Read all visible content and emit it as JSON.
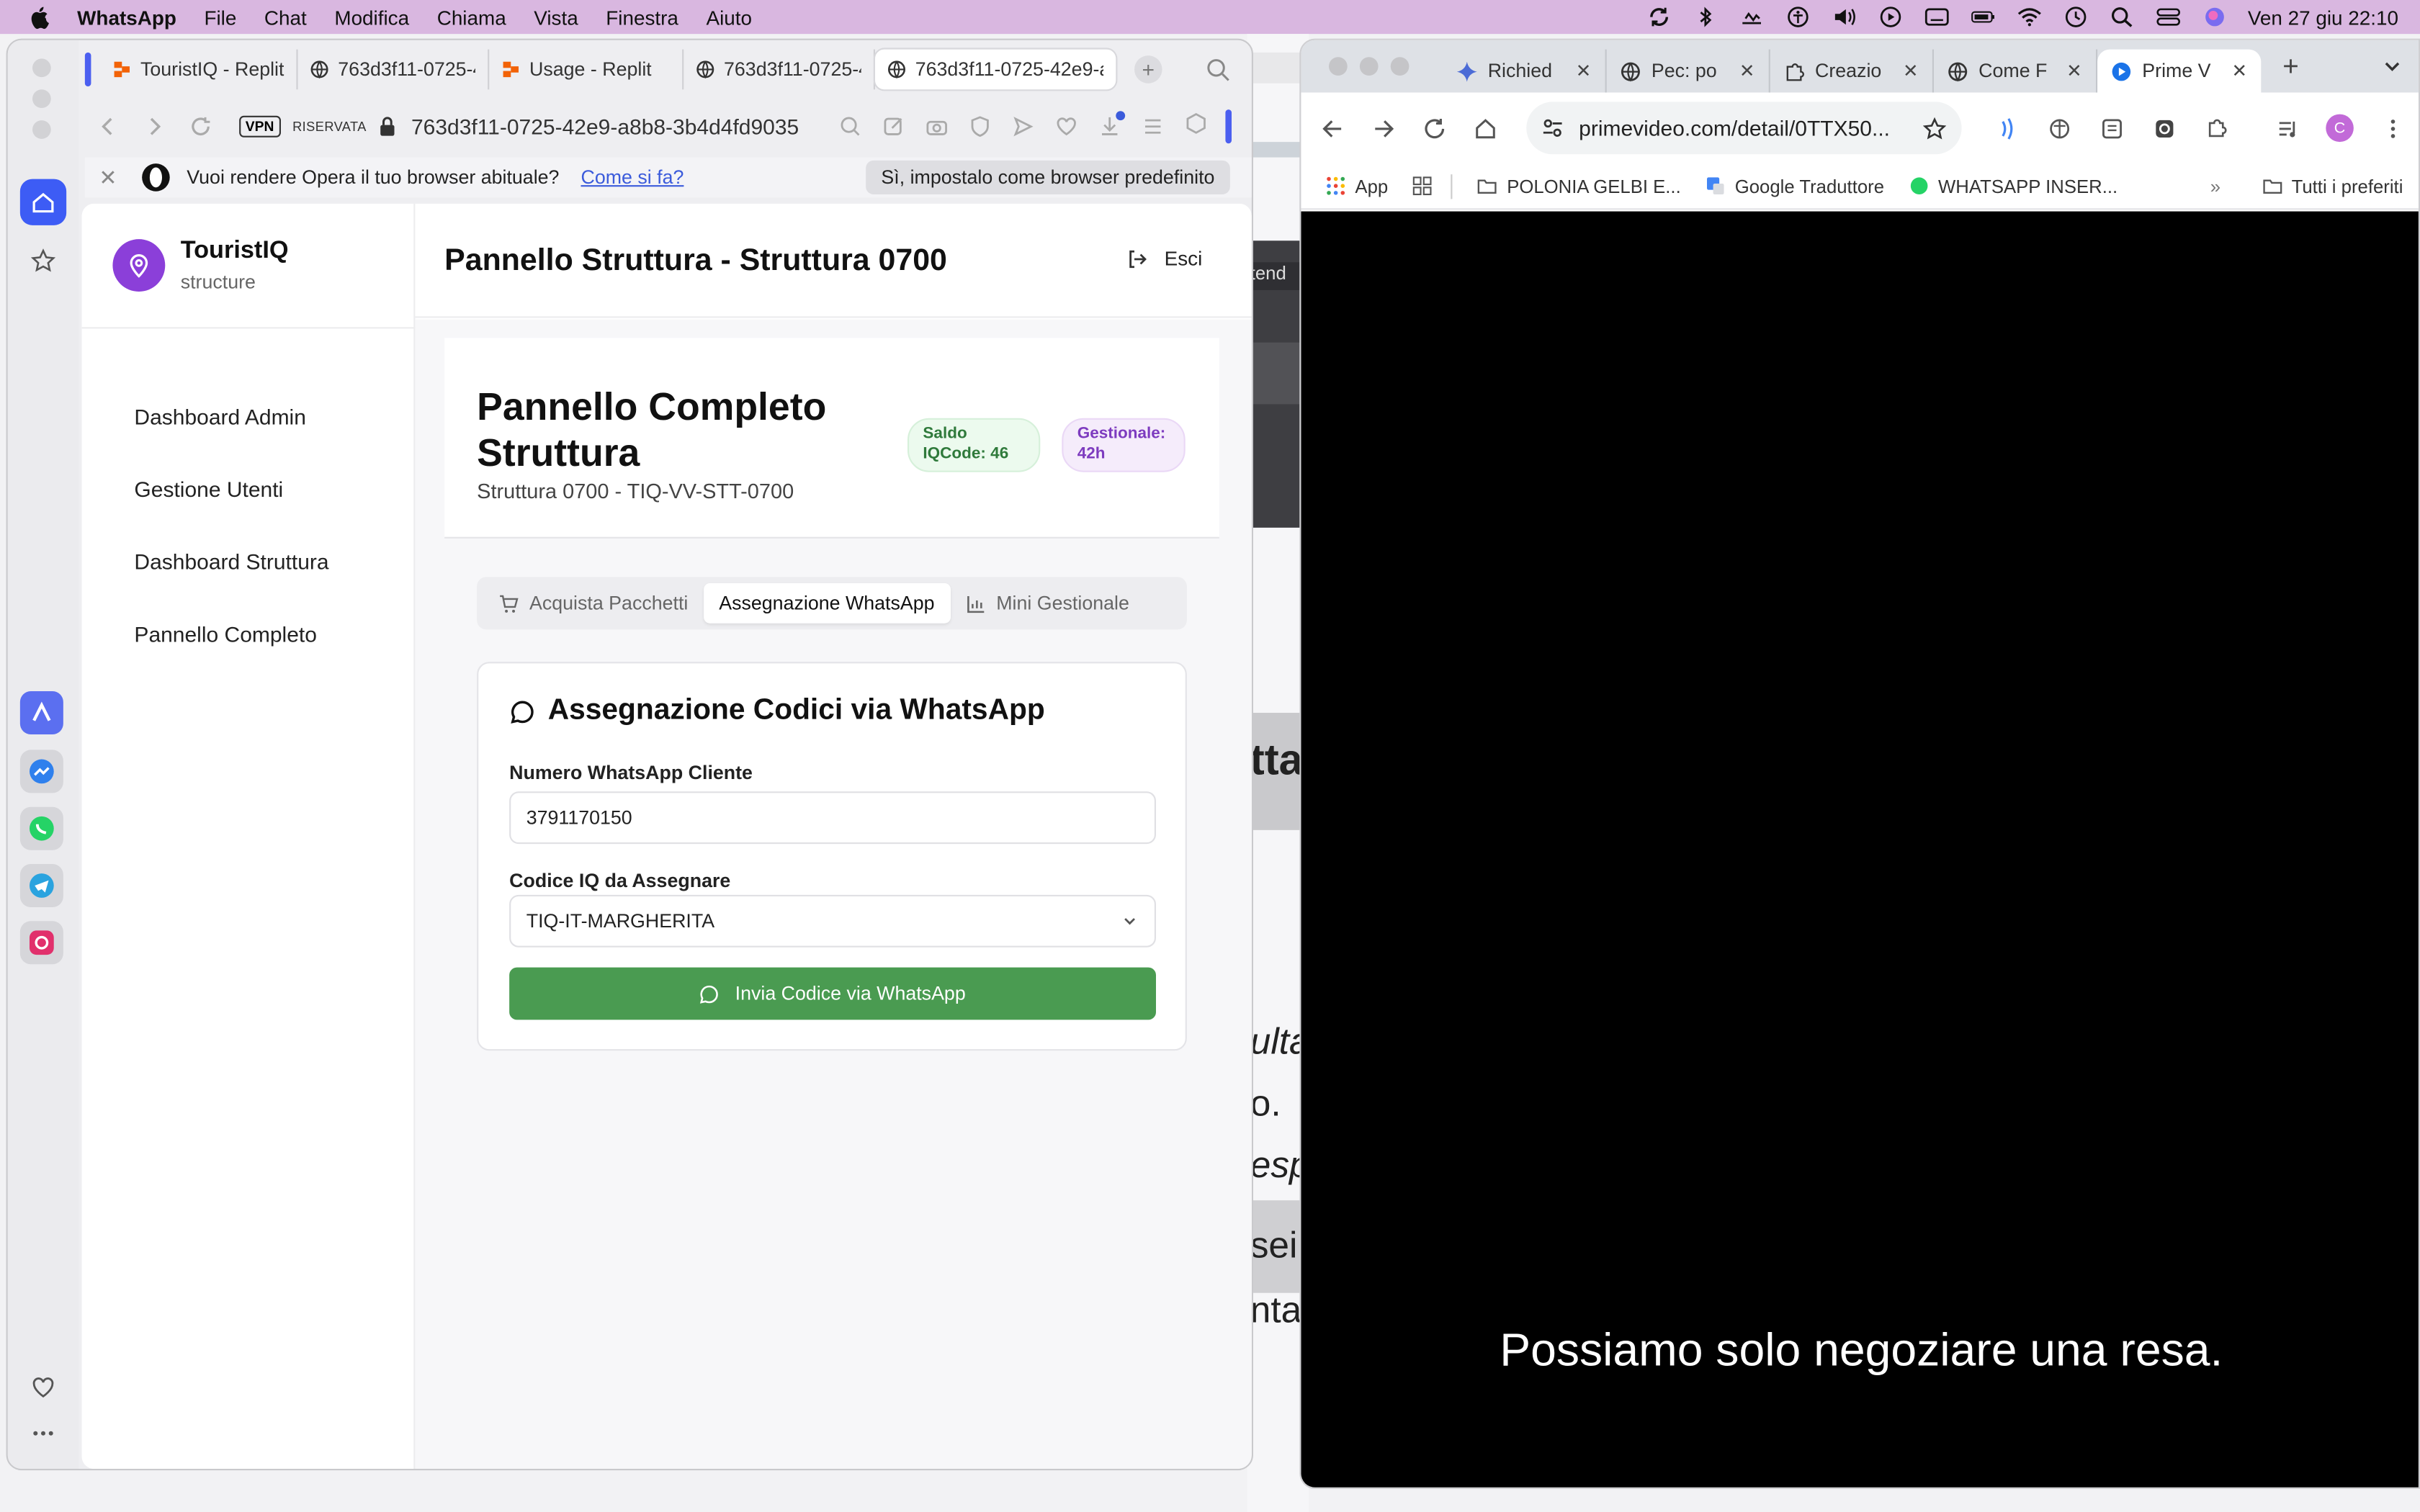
{
  "menubar": {
    "app": "WhatsApp",
    "items": [
      "File",
      "Chat",
      "Modifica",
      "Chiama",
      "Vista",
      "Finestra",
      "Aiuto"
    ],
    "clock": "Ven 27 giu  22:10"
  },
  "opera": {
    "tabs": [
      {
        "label": "TouristIQ - Replit",
        "icon": "replit-icon"
      },
      {
        "label": "763d3f11-0725-4",
        "icon": "globe-icon"
      },
      {
        "label": "Usage - Replit",
        "icon": "replit-icon"
      },
      {
        "label": "763d3f11-0725-4",
        "icon": "globe-icon"
      },
      {
        "label": "763d3f11-0725-42e9-a",
        "icon": "globe-icon"
      }
    ],
    "vpn_label": "VPN",
    "privacy_label": "RISERVATA",
    "url": "763d3f11-0725-42e9-a8b8-3b4d4fd9035",
    "infobar": {
      "message": "Vuoi rendere Opera il tuo browser abituale?",
      "link": "Come si fa?",
      "button": "Sì, impostalo come browser predefinito"
    }
  },
  "app": {
    "brand_name": "TouristIQ",
    "brand_sub": "structure",
    "header_title": "Pannello Struttura - Struttura 0700",
    "logout_label": "Esci",
    "nav": [
      "Dashboard Admin",
      "Gestione Utenti",
      "Dashboard Struttura",
      "Pannello Completo"
    ],
    "panel": {
      "title": "Pannello Completo Struttura",
      "subtitle": "Struttura 0700 - TIQ-VV-STT-0700",
      "badge_saldo": "Saldo IQCode: 46",
      "badge_gestionale": "Gestionale: 42h"
    },
    "tabs": [
      "Acquista Pacchetti",
      "Assegnazione WhatsApp",
      "Mini Gestionale"
    ],
    "active_tab": "Assegnazione WhatsApp",
    "card": {
      "title": "Assegnazione Codici via WhatsApp",
      "phone_label": "Numero WhatsApp Cliente",
      "phone_value": "3791170150",
      "code_label": "Codice IQ da Assegnare",
      "code_value": "TIQ-IT-MARGHERITA",
      "send_button": "Invia Codice via WhatsApp"
    }
  },
  "chrome": {
    "tabs": [
      {
        "label": "Richied",
        "icon": "gemini-icon"
      },
      {
        "label": "Pec: po",
        "icon": "globe-icon"
      },
      {
        "label": "Creazio",
        "icon": "puzzle-icon"
      },
      {
        "label": "Come F",
        "icon": "globe-icon"
      },
      {
        "label": "Prime V",
        "icon": "prime-video-icon"
      }
    ],
    "url": "primevideo.com/detail/0TTX50...",
    "avatar_letter": "C",
    "bookmarks": [
      "App",
      "POLONIA GELBI E...",
      "Google Traduttore",
      "WHATSAPP INSER..."
    ],
    "bookmarks_all": "Tutti i preferiti",
    "subtitle": "Possiamo solo negoziare una resa."
  },
  "behind_fragments": [
    "tend",
    "tta",
    "ulta",
    "o.",
    "esp",
    "sei",
    "nta"
  ],
  "colors": {
    "menubar_bg": "#d9b7e0",
    "brand_purple": "#8b3fd9",
    "send_green": "#4a9b51",
    "opera_home_blue": "#3d5cf5"
  }
}
